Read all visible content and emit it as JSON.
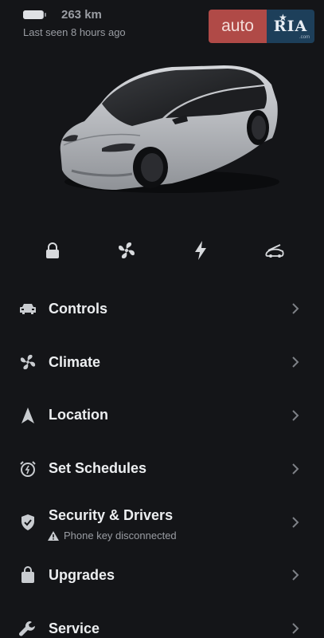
{
  "header": {
    "range": "263 km",
    "last_seen": "Last seen 8 hours ago",
    "battery_level": 0.95
  },
  "logo": {
    "auto": "auto",
    "ria": "RIA",
    "com": ".com"
  },
  "quick_actions": [
    {
      "icon": "lock-icon"
    },
    {
      "icon": "fan-icon"
    },
    {
      "icon": "bolt-icon"
    },
    {
      "icon": "frunk-icon"
    }
  ],
  "menu": [
    {
      "label": "Controls",
      "icon": "car-icon"
    },
    {
      "label": "Climate",
      "icon": "fan-icon"
    },
    {
      "label": "Location",
      "icon": "navigation-arrow-icon"
    },
    {
      "label": "Set Schedules",
      "icon": "alarm-clock-icon"
    },
    {
      "label": "Security & Drivers",
      "icon": "shield-icon",
      "subtitle": "Phone key disconnected",
      "subtitle_icon": "warning-icon"
    },
    {
      "label": "Upgrades",
      "icon": "shopping-bag-icon"
    },
    {
      "label": "Service",
      "icon": "wrench-icon"
    }
  ],
  "colors": {
    "background": "#141518",
    "text": "#eceef0",
    "muted": "#9a9da3",
    "logo_auto": "#b04a47",
    "logo_ria": "#1d3f5a"
  }
}
